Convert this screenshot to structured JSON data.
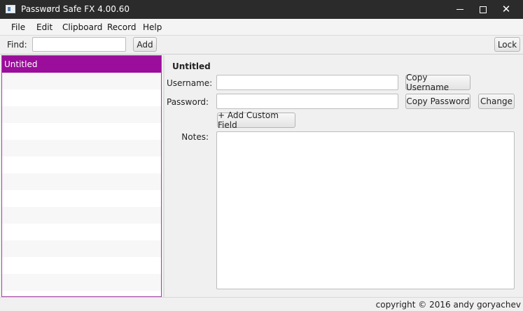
{
  "window": {
    "title": "Passwørd Safe FX 4.00.60"
  },
  "menu": {
    "items": [
      "File",
      "Edit",
      "Clipboard",
      "Record",
      "Help"
    ]
  },
  "toolbar": {
    "find_label": "Find:",
    "find_value": "",
    "add_label": "Add",
    "lock_label": "Lock"
  },
  "records": {
    "items": [
      "Untitled"
    ],
    "selected": "Untitled"
  },
  "detail": {
    "title": "Untitled",
    "username_label": "Username:",
    "username_value": "",
    "copy_username_label": "Copy Username",
    "password_label": "Password:",
    "password_value": "",
    "copy_password_label": "Copy Password",
    "change_label": "Change",
    "add_custom_field_label": "+ Add Custom Field",
    "notes_label": "Notes:",
    "notes_value": ""
  },
  "status": {
    "copyright": "copyright © 2016 andy goryachev"
  },
  "colors": {
    "selection": "#9b0d9b",
    "titlebar": "#2b2b2b"
  }
}
